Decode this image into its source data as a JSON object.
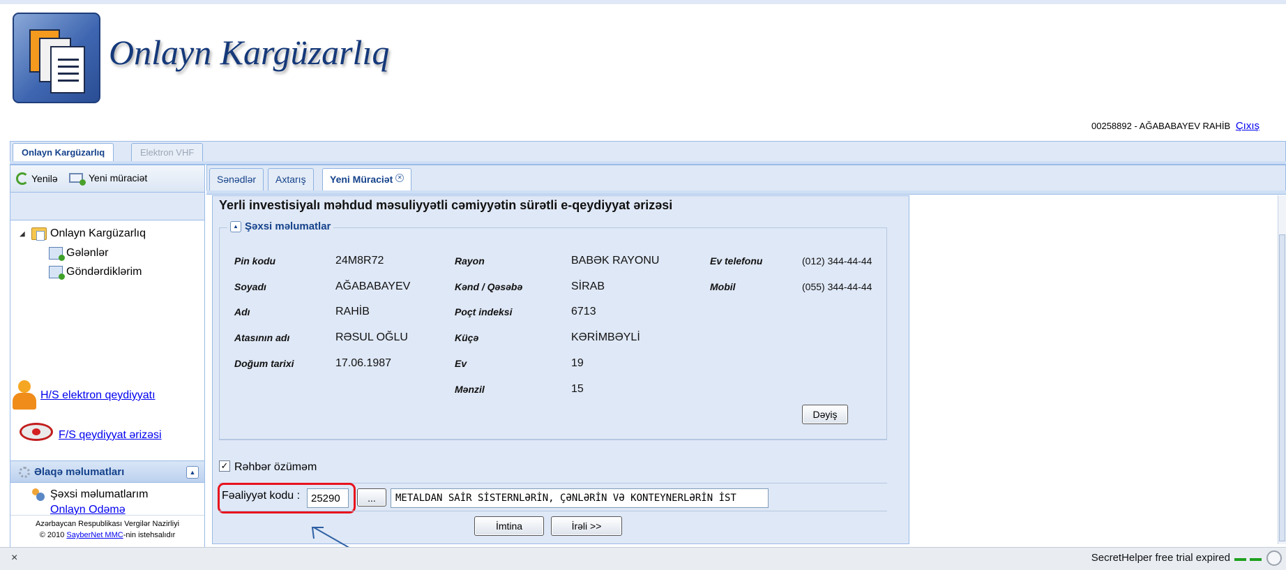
{
  "header": {
    "app_title": "Onlayn Kargüzarlıq",
    "user_info": "00258892 - AĞABABAYEV RAHİB",
    "logout_label": "Çıxış"
  },
  "app_tabs": [
    {
      "label": "Onlayn Kargüzarlıq",
      "active": true
    },
    {
      "label": "Elektron VHF",
      "active": false
    }
  ],
  "left_toolbar": {
    "refresh_label": "Yenilə",
    "new_request_label": "Yeni müraciət"
  },
  "tree": {
    "root": "Onlayn Kargüzarlıq",
    "items": [
      "Gələnlər",
      "Göndərdiklərim"
    ]
  },
  "promo_links": [
    {
      "label": "H/S elektron qeydiyyatı"
    },
    {
      "label": "F/S qeydiyyat ərizəsi"
    }
  ],
  "contact_panel": {
    "title": "Əlaqə məlumatları",
    "items": [
      "Şəxsi məlumatlarım",
      "Onlayn Ödəmə"
    ]
  },
  "footer": {
    "line1": "Azərbaycan Respublikası Vergilər Nazirliyi",
    "line2_prefix": "© 2010 ",
    "line2_link": "SayberNet MMC",
    "line2_suffix": "-nin istehsalıdır"
  },
  "doc_tabs": [
    {
      "label": "Sənədlər",
      "active": false
    },
    {
      "label": "Axtarış",
      "active": false
    },
    {
      "label": "Yeni Müraciət",
      "active": true
    }
  ],
  "form": {
    "title": "Yerli investisiyalı məhdud məsuliyyətli cəmiyyətin sürətli e-qeydiyyat ərizəsi",
    "section_title": "Şəxsi məlumatlar",
    "col1": [
      {
        "label": "Pin kodu",
        "value": "24M8R72"
      },
      {
        "label": "Soyadı",
        "value": "AĞABABAYEV"
      },
      {
        "label": "Adı",
        "value": "RAHİB"
      },
      {
        "label": "Atasının adı",
        "value": "RƏSUL OĞLU"
      },
      {
        "label": "Doğum tarixi",
        "value": "17.06.1987"
      }
    ],
    "col2": [
      {
        "label": "Rayon",
        "value": "BABƏK RAYONU"
      },
      {
        "label": "Kənd / Qəsəbə",
        "value": "SİRAB"
      },
      {
        "label": "Poçt indeksi",
        "value": "6713"
      },
      {
        "label": "Küçə",
        "value": "KƏRİMBƏYLİ"
      },
      {
        "label": "Ev",
        "value": "19"
      },
      {
        "label": "Mənzil",
        "value": "15"
      }
    ],
    "col3": [
      {
        "label": "Ev telefonu",
        "value": "(012) 344-44-44"
      },
      {
        "label": "Mobil",
        "value": "(055) 344-44-44"
      }
    ],
    "change_label": "Dəyiş",
    "checkbox_label": "Rəhbər özüməm",
    "checkbox_checked": true,
    "activity_code_label": "Fəaliyyət kodu :",
    "activity_code_value": "25290",
    "browse_label": "...",
    "activity_desc_value": "METALDAN SAİR SİSTERNLƏRİN, ÇƏNLƏRİN VƏ KONTEYNERLƏRİN İST",
    "cancel_label": "İmtina",
    "next_label": "İrəli >>"
  },
  "status_bar": {
    "close_label": "×",
    "text": "SecretHelper free trial expired"
  },
  "colors": {
    "brand_blue": "#15397a",
    "highlight_red": "#e8121d",
    "panel_bg": "#dfe8f6",
    "link": "#0000ee"
  },
  "icons": [
    "refresh-icon",
    "mail-icon",
    "folder-icon",
    "inbox-icon",
    "person-icon",
    "stamp-icon",
    "gear-icon",
    "users-icon"
  ]
}
